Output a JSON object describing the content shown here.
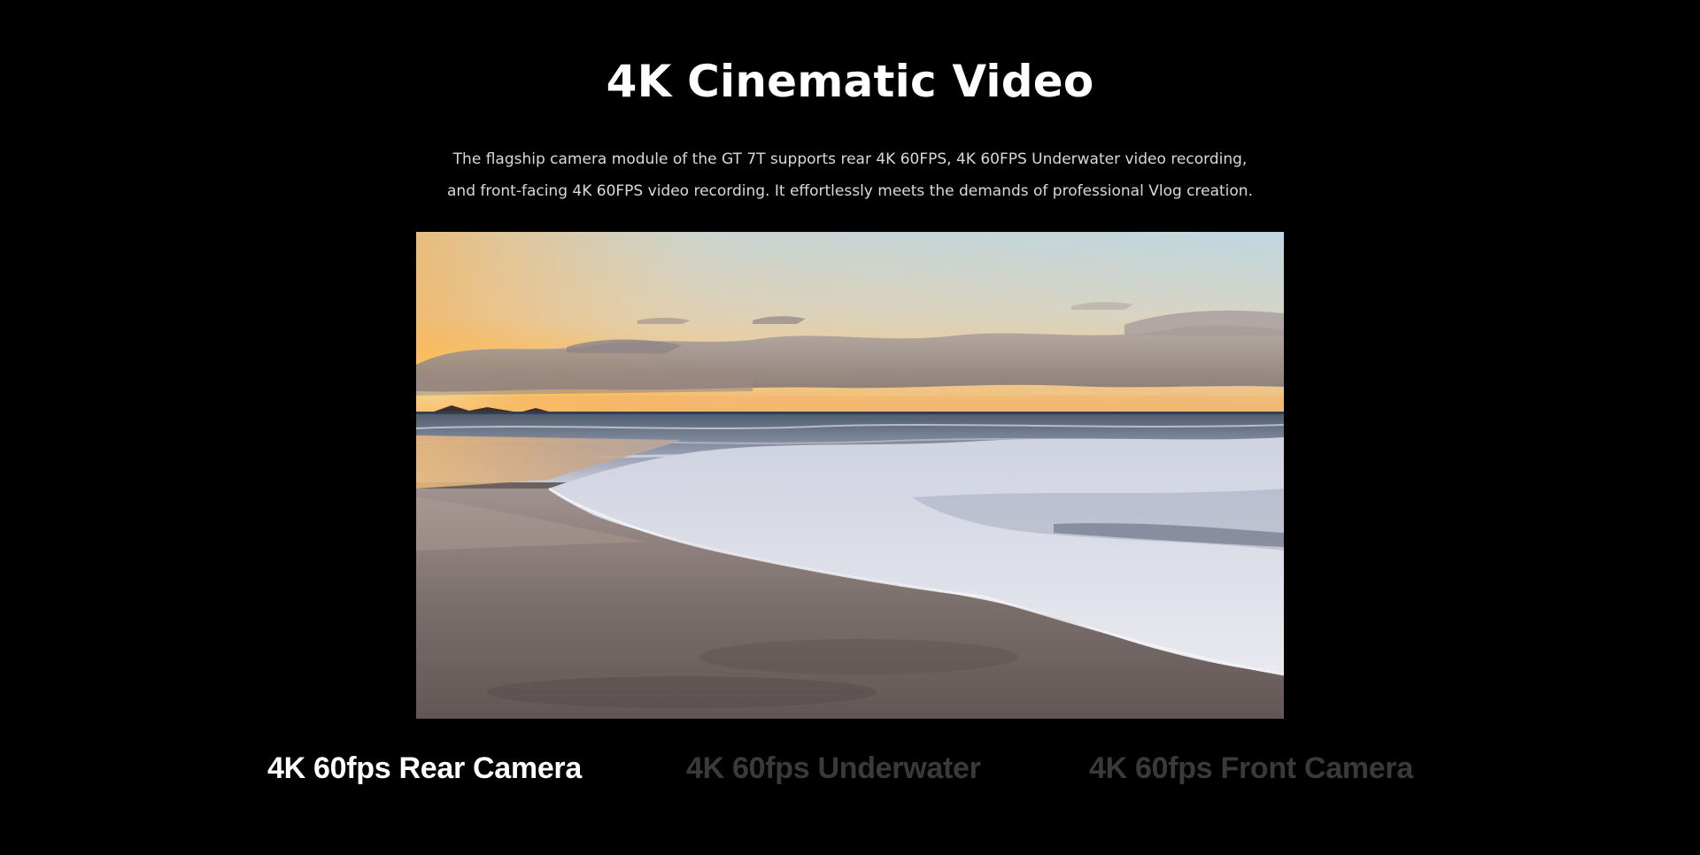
{
  "section": {
    "title": "4K Cinematic Video",
    "description_line1": "The flagship camera module of the GT 7T supports rear 4K 60FPS, 4K 60FPS Underwater video recording,",
    "description_line2": "and front-facing 4K 60FPS video recording. It effortlessly meets the demands of professional Vlog creation."
  },
  "video": {
    "scene": "beach-sunset-video"
  },
  "tabs": [
    {
      "label": "4K 60fps Rear Camera",
      "active": true
    },
    {
      "label": "4K 60fps Underwater",
      "active": false
    },
    {
      "label": "4K 60fps Front Camera",
      "active": false
    }
  ],
  "colors": {
    "background": "#000000",
    "active_tab": "#ffffff",
    "inactive_tab": "#3a3a3a",
    "description": "#d9d9d9"
  }
}
